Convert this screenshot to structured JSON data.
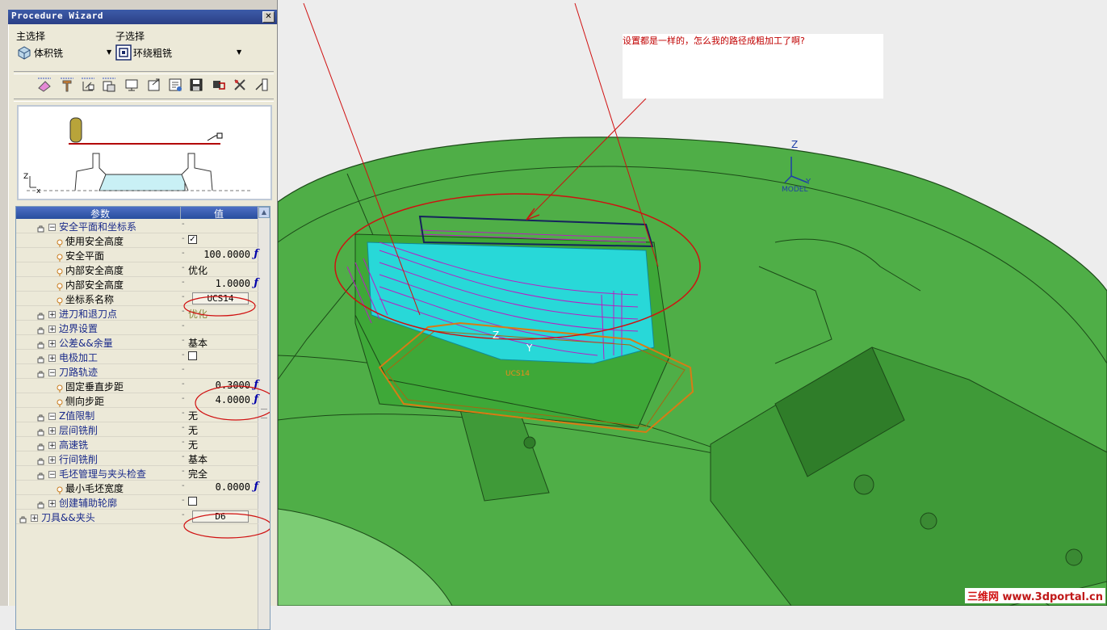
{
  "wizard": {
    "title": "Procedure Wizard",
    "main_select_label": "主选择",
    "sub_select_label": "子选择",
    "main_select_value": "体积铣",
    "sub_select_value": "环绕粗铣",
    "preview_axes": {
      "z": "Z",
      "x": "x"
    },
    "grid": {
      "col_param": "参数",
      "col_value": "值",
      "rows": [
        {
          "label": "安全平面和坐标系",
          "kind": "group",
          "expanded": true,
          "value": ""
        },
        {
          "label": "使用安全高度",
          "kind": "sub",
          "value": "✓",
          "type": "checkbox"
        },
        {
          "label": "安全平面",
          "kind": "sub",
          "value": "100.0000",
          "type": "num",
          "prefix": "c"
        },
        {
          "label": "内部安全高度",
          "kind": "sub",
          "value": "优化",
          "type": "text"
        },
        {
          "label": "内部安全高度",
          "kind": "sub",
          "value": "1.0000",
          "type": "num",
          "prefix": "a"
        },
        {
          "label": "坐标系名称",
          "kind": "sub",
          "value": "UCS14",
          "type": "button"
        },
        {
          "label": "进刀和退刀点",
          "kind": "group",
          "expanded": false,
          "value": "优化"
        },
        {
          "label": "边界设置",
          "kind": "group",
          "expanded": false,
          "value": ""
        },
        {
          "label": "公差&&余量",
          "kind": "group",
          "expanded": false,
          "value": "基本"
        },
        {
          "label": "电极加工",
          "kind": "group",
          "expanded": false,
          "value": "",
          "type": "checkbox"
        },
        {
          "label": "刀路轨迹",
          "kind": "group",
          "expanded": true,
          "value": ""
        },
        {
          "label": "固定垂直步距",
          "kind": "sub",
          "value": "0.3000",
          "type": "num",
          "prefix": "p"
        },
        {
          "label": "侧向步距",
          "kind": "sub",
          "value": "4.0000",
          "type": "num",
          "prefix": "c"
        },
        {
          "label": "Z值限制",
          "kind": "group",
          "expanded": true,
          "value": "无"
        },
        {
          "label": "层间铣削",
          "kind": "group",
          "expanded": false,
          "value": "无"
        },
        {
          "label": "高速铣",
          "kind": "group",
          "expanded": false,
          "value": "无"
        },
        {
          "label": "行间铣削",
          "kind": "group",
          "expanded": false,
          "value": "基本"
        },
        {
          "label": "毛坯管理与夹头检查",
          "kind": "group",
          "expanded": true,
          "value": "完全"
        },
        {
          "label": "最小毛坯宽度",
          "kind": "sub",
          "value": "0.0000",
          "type": "num",
          "prefix": ""
        },
        {
          "label": "创建辅助轮廓",
          "kind": "group",
          "expanded": false,
          "value": "",
          "type": "checkbox"
        },
        {
          "label": "刀具&&夹头",
          "kind": "group",
          "expanded": false,
          "value": "D6",
          "type": "button",
          "top": true
        }
      ]
    }
  },
  "viewport": {
    "annotation": "设置都是一样的，怎么我的路径成粗加工了啊?",
    "axis": {
      "z": "Z",
      "y": "Y",
      "model": "MODEL"
    },
    "part_axis": {
      "z": "Z",
      "y": "Y",
      "tag": "UCS14"
    },
    "watermark": {
      "cn": "三维网",
      "url": "www.3dportal.cn"
    }
  }
}
